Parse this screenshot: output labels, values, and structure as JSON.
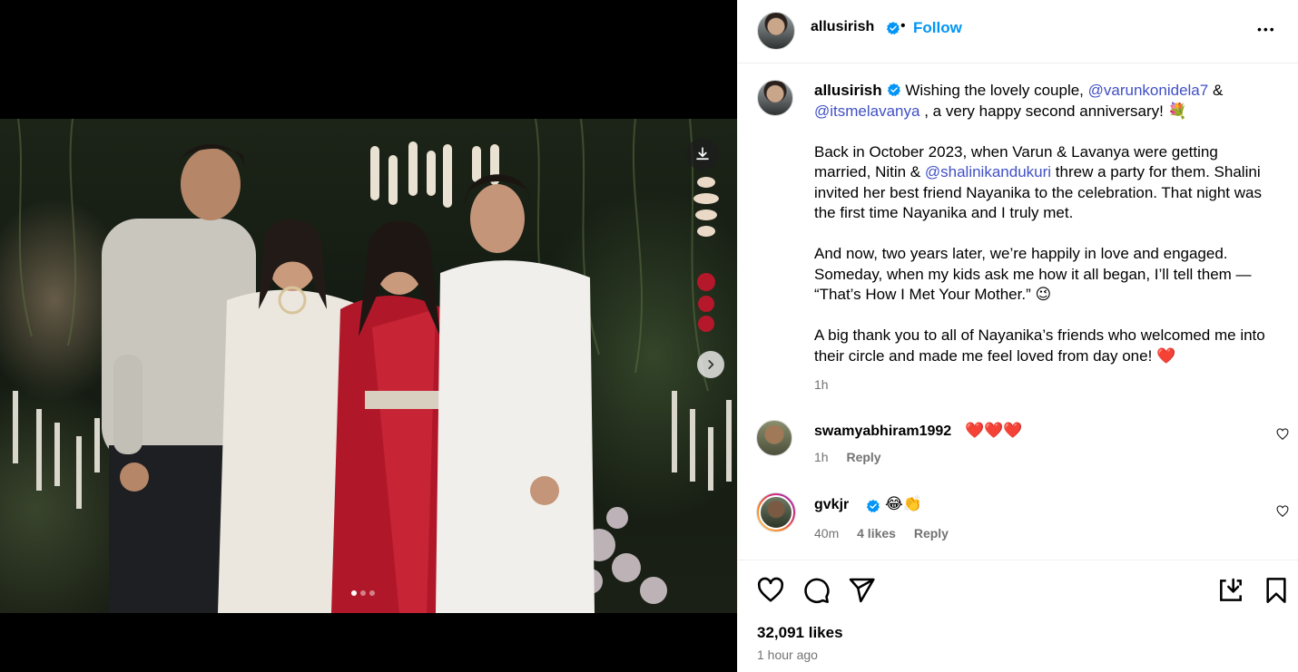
{
  "post": {
    "author": "allusirish",
    "follow_label": "Follow",
    "separator": "•",
    "more_label": "•••"
  },
  "caption": {
    "author": "allusirish",
    "p1_a": " Wishing the lovely couple, ",
    "p1_mention1": "@varunkonidela7",
    "p1_b": " & ",
    "p1_mention2": "@itsmelavanya",
    "p1_c": " , a very happy second anniversary! ",
    "p1_emoji": "💐",
    "p2_a": "Back in October 2023, when Varun & Lavanya were getting married, Nitin & ",
    "p2_mention": "@shalinikandukuri",
    "p2_b": " threw a party for them. Shalini invited her best friend Nayanika to the celebration. That night was the first time Nayanika and I truly met.",
    "p3_a": "And now, two years later, we’re happily in love and engaged. Someday, when my kids ask me how it all began, I’ll tell them — “That’s How I Met Your Mother.” ",
    "p3_emoji": "😉",
    "p4_a": "A big thank you to all of Nayanika’s friends who welcomed me into their circle and made me feel loved from day one! ",
    "p4_emoji": "❤️",
    "time": "1h"
  },
  "comments": [
    {
      "user": "swamyabhiram1992",
      "text": "❤️❤️❤️",
      "time": "1h",
      "likes": "",
      "reply": "Reply"
    },
    {
      "user": "gvkjr",
      "text": "😂👏",
      "time": "40m",
      "likes": "4 likes",
      "reply": "Reply"
    }
  ],
  "stats": {
    "likes": "32,091 likes",
    "posted": "1 hour ago"
  },
  "colors": {
    "accent": "#0095f6",
    "mention": "#4150c4",
    "muted": "#737373",
    "verified": "#0095f6"
  },
  "carousel": {
    "count": 3,
    "active": 1
  }
}
